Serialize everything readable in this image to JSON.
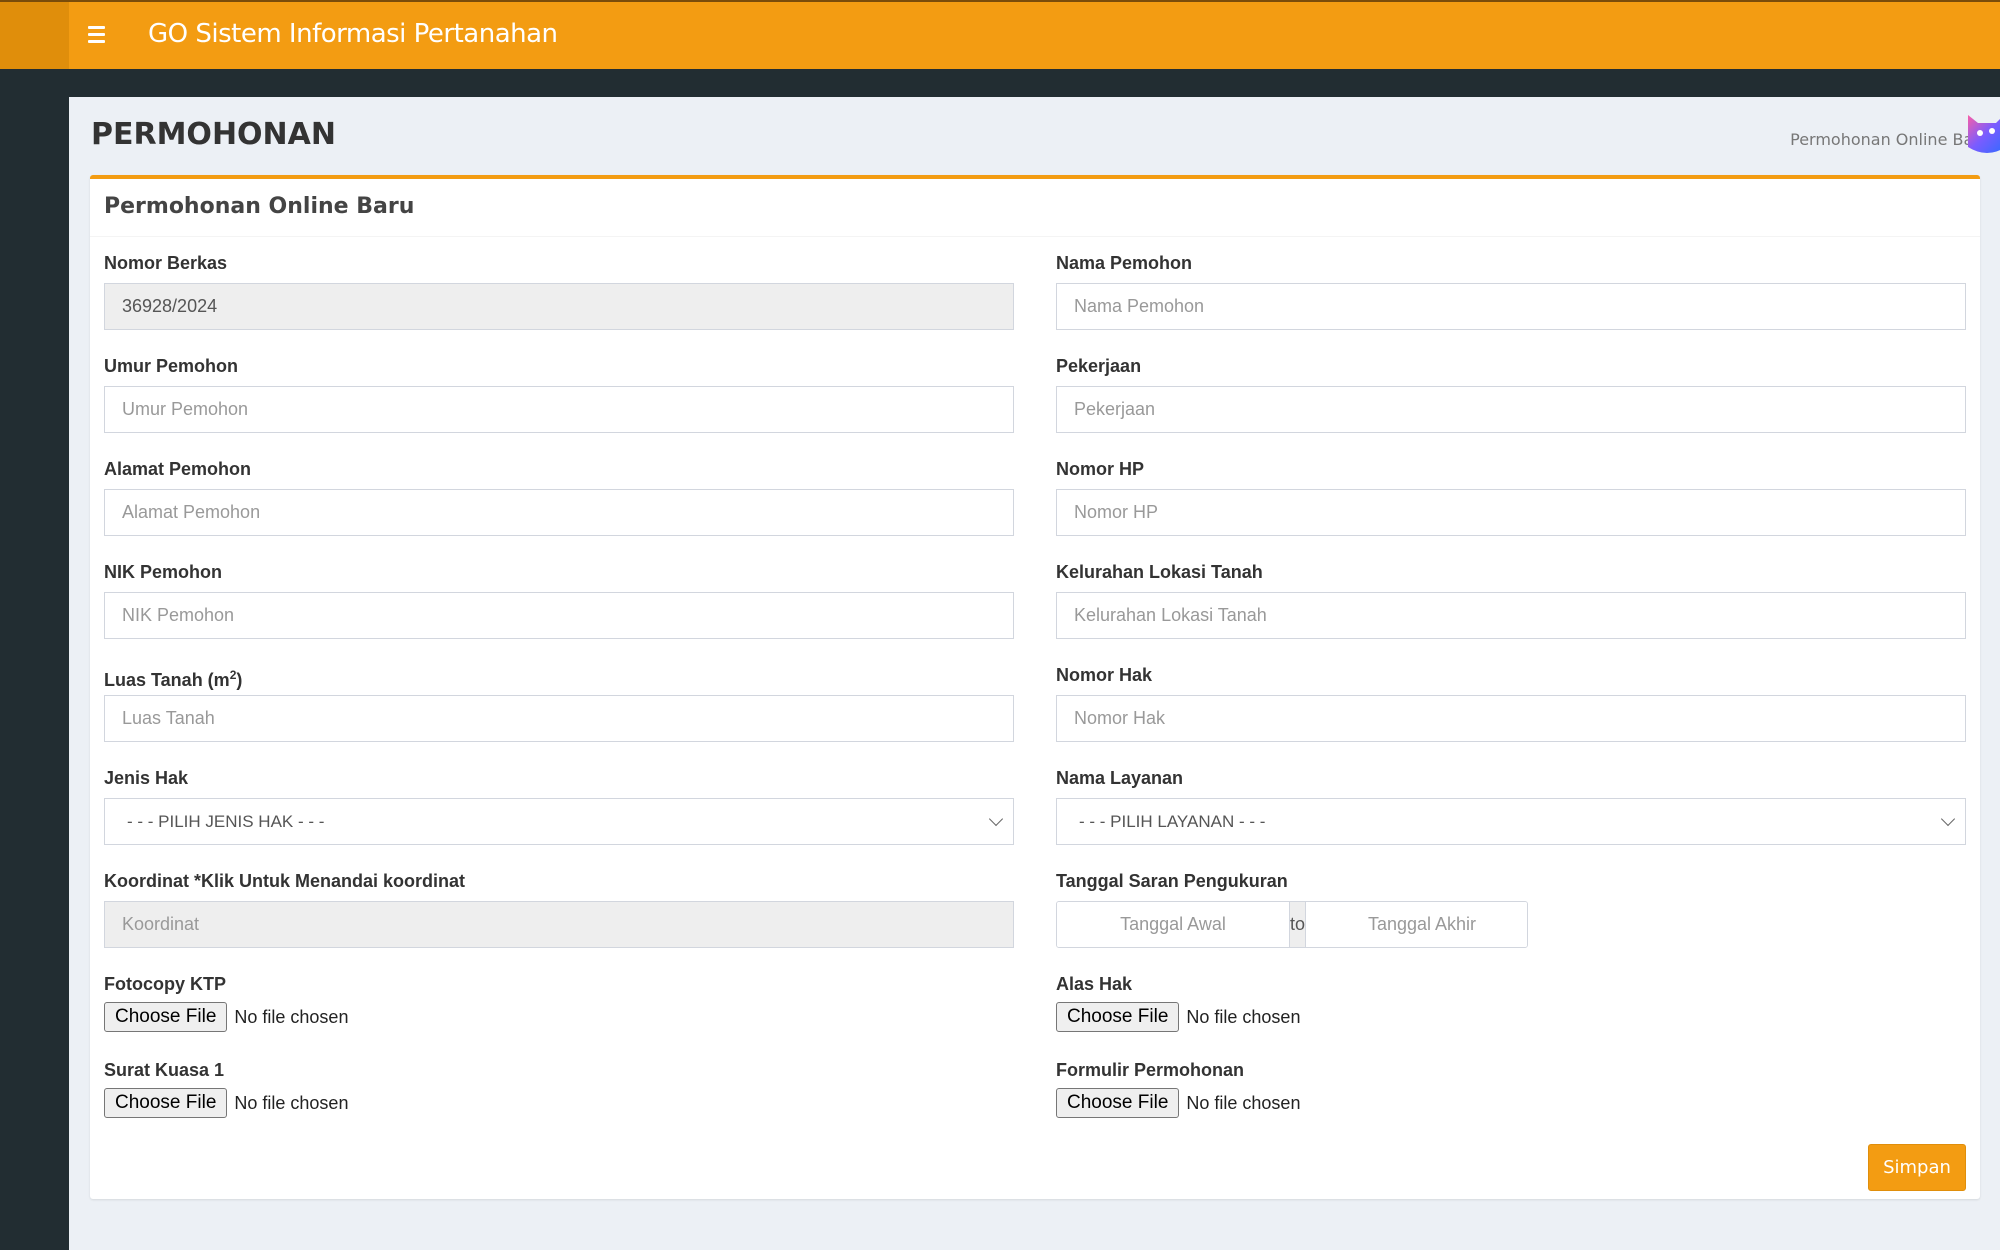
{
  "header": {
    "menu_icon": "hamburger-icon",
    "app_title": "GO Sistem Informasi Pertanahan"
  },
  "page": {
    "title": "PERMOHONAN",
    "breadcrumb": "Permohonan Online Baru"
  },
  "form": {
    "title": "Permohonan Online Baru",
    "fields": {
      "nomor_berkas": {
        "label": "Nomor Berkas",
        "value": "36928/2024",
        "placeholder": ""
      },
      "nama_pemohon": {
        "label": "Nama Pemohon",
        "value": "",
        "placeholder": "Nama Pemohon"
      },
      "umur_pemohon": {
        "label": "Umur Pemohon",
        "value": "",
        "placeholder": "Umur Pemohon"
      },
      "pekerjaan": {
        "label": "Pekerjaan",
        "value": "",
        "placeholder": "Pekerjaan"
      },
      "alamat_pemohon": {
        "label": "Alamat Pemohon",
        "value": "",
        "placeholder": "Alamat Pemohon"
      },
      "nomor_hp": {
        "label": "Nomor HP",
        "value": "",
        "placeholder": "Nomor HP"
      },
      "nik_pemohon": {
        "label": "NIK Pemohon",
        "value": "",
        "placeholder": "NIK Pemohon"
      },
      "kelurahan": {
        "label": "Kelurahan Lokasi Tanah",
        "value": "",
        "placeholder": "Kelurahan Lokasi Tanah"
      },
      "luas_tanah": {
        "label": "Luas Tanah (m",
        "label_sup": "2",
        "label_end": ")",
        "value": "",
        "placeholder": "Luas Tanah"
      },
      "nomor_hak": {
        "label": "Nomor Hak",
        "value": "",
        "placeholder": "Nomor Hak"
      },
      "jenis_hak": {
        "label": "Jenis Hak",
        "selected": "- - - PILIH JENIS HAK - - -"
      },
      "nama_layanan": {
        "label": "Nama Layanan",
        "selected": "- - - PILIH LAYANAN - - -"
      },
      "koordinat": {
        "label": "Koordinat *Klik Untuk Menandai koordinat",
        "value": "",
        "placeholder": "Koordinat"
      },
      "tanggal_saran": {
        "label": "Tanggal Saran Pengukuran",
        "start_placeholder": "Tanggal Awal",
        "separator": "to",
        "end_placeholder": "Tanggal Akhir"
      },
      "fotocopy_ktp": {
        "label": "Fotocopy KTP",
        "button": "Choose File",
        "status": "No file chosen"
      },
      "alas_hak": {
        "label": "Alas Hak",
        "button": "Choose File",
        "status": "No file chosen"
      },
      "surat_kuasa": {
        "label": "Surat Kuasa 1",
        "button": "Choose File",
        "status": "No file chosen"
      },
      "formulir": {
        "label": "Formulir Permohonan",
        "button": "Choose File",
        "status": "No file chosen"
      }
    },
    "save_label": "Simpan"
  },
  "colors": {
    "accent": "#f39c12",
    "sidebar": "#222d32",
    "content_bg": "#ecf0f5"
  }
}
